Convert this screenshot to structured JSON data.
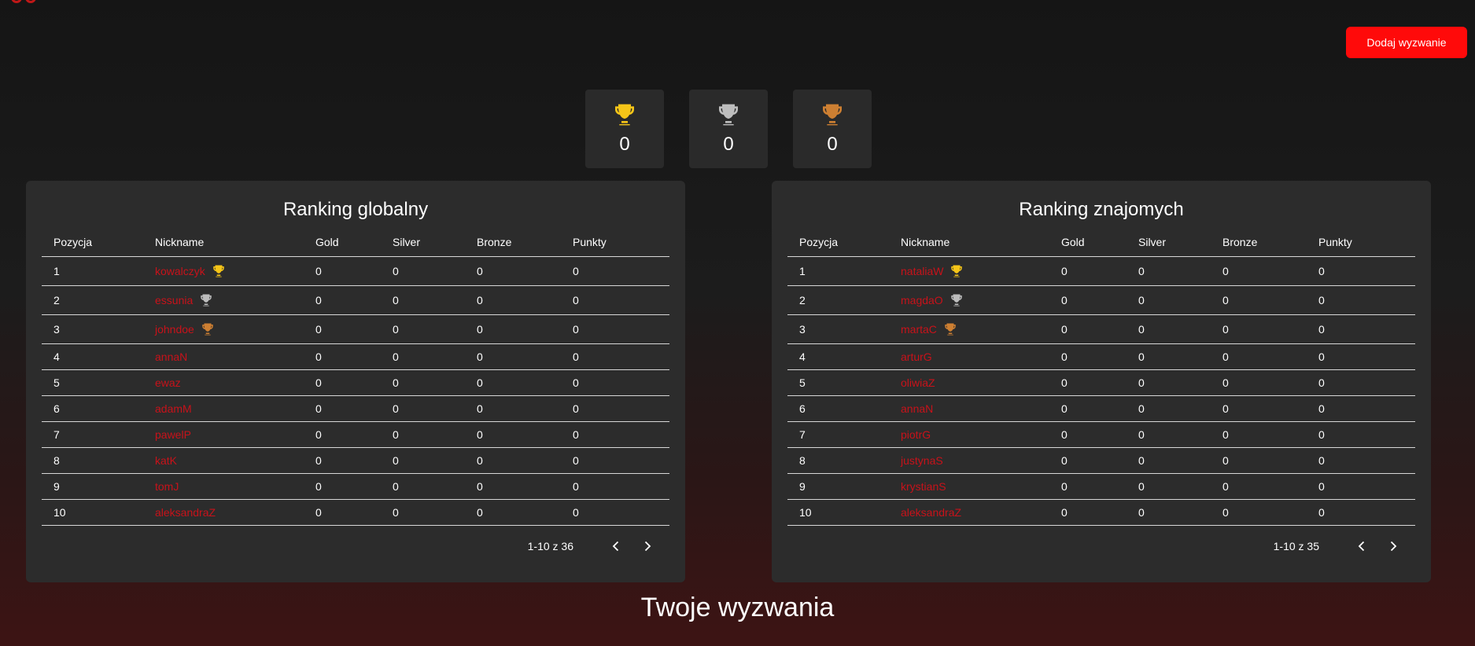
{
  "colors": {
    "accent": "#ff0a0a",
    "nickname": "#c8121a",
    "gold": "#f5c518",
    "silver": "#bdbdbd",
    "bronze": "#cd7f32"
  },
  "header": {
    "add_challenge_label": "Dodaj wyzwanie"
  },
  "trophies": [
    {
      "medal": "gold",
      "icon": "trophy-icon",
      "count": "0"
    },
    {
      "medal": "silver",
      "icon": "trophy-icon",
      "count": "0"
    },
    {
      "medal": "bronze",
      "icon": "trophy-icon",
      "count": "0"
    }
  ],
  "rankings": [
    {
      "title": "Ranking globalny",
      "columns": [
        "Pozycja",
        "Nickname",
        "Gold",
        "Silver",
        "Bronze",
        "Punkty"
      ],
      "rows": [
        {
          "pos": "1",
          "nick": "kowalczyk",
          "medal": "gold",
          "gold": "0",
          "silver": "0",
          "bronze": "0",
          "points": "0"
        },
        {
          "pos": "2",
          "nick": "essunia",
          "medal": "silver",
          "gold": "0",
          "silver": "0",
          "bronze": "0",
          "points": "0"
        },
        {
          "pos": "3",
          "nick": "johndoe",
          "medal": "bronze",
          "gold": "0",
          "silver": "0",
          "bronze": "0",
          "points": "0"
        },
        {
          "pos": "4",
          "nick": "annaN",
          "medal": "",
          "gold": "0",
          "silver": "0",
          "bronze": "0",
          "points": "0"
        },
        {
          "pos": "5",
          "nick": "ewaz",
          "medal": "",
          "gold": "0",
          "silver": "0",
          "bronze": "0",
          "points": "0"
        },
        {
          "pos": "6",
          "nick": "adamM",
          "medal": "",
          "gold": "0",
          "silver": "0",
          "bronze": "0",
          "points": "0"
        },
        {
          "pos": "7",
          "nick": "pawelP",
          "medal": "",
          "gold": "0",
          "silver": "0",
          "bronze": "0",
          "points": "0"
        },
        {
          "pos": "8",
          "nick": "katK",
          "medal": "",
          "gold": "0",
          "silver": "0",
          "bronze": "0",
          "points": "0"
        },
        {
          "pos": "9",
          "nick": "tomJ",
          "medal": "",
          "gold": "0",
          "silver": "0",
          "bronze": "0",
          "points": "0"
        },
        {
          "pos": "10",
          "nick": "aleksandraZ",
          "medal": "",
          "gold": "0",
          "silver": "0",
          "bronze": "0",
          "points": "0"
        }
      ],
      "pagination": "1-10 z 36"
    },
    {
      "title": "Ranking znajomych",
      "columns": [
        "Pozycja",
        "Nickname",
        "Gold",
        "Silver",
        "Bronze",
        "Punkty"
      ],
      "rows": [
        {
          "pos": "1",
          "nick": "nataliaW",
          "medal": "gold",
          "gold": "0",
          "silver": "0",
          "bronze": "0",
          "points": "0"
        },
        {
          "pos": "2",
          "nick": "magdaO",
          "medal": "silver",
          "gold": "0",
          "silver": "0",
          "bronze": "0",
          "points": "0"
        },
        {
          "pos": "3",
          "nick": "martaC",
          "medal": "bronze",
          "gold": "0",
          "silver": "0",
          "bronze": "0",
          "points": "0"
        },
        {
          "pos": "4",
          "nick": "arturG",
          "medal": "",
          "gold": "0",
          "silver": "0",
          "bronze": "0",
          "points": "0"
        },
        {
          "pos": "5",
          "nick": "oliwiaZ",
          "medal": "",
          "gold": "0",
          "silver": "0",
          "bronze": "0",
          "points": "0"
        },
        {
          "pos": "6",
          "nick": "annaN",
          "medal": "",
          "gold": "0",
          "silver": "0",
          "bronze": "0",
          "points": "0"
        },
        {
          "pos": "7",
          "nick": "piotrG",
          "medal": "",
          "gold": "0",
          "silver": "0",
          "bronze": "0",
          "points": "0"
        },
        {
          "pos": "8",
          "nick": "justynaS",
          "medal": "",
          "gold": "0",
          "silver": "0",
          "bronze": "0",
          "points": "0"
        },
        {
          "pos": "9",
          "nick": "krystianS",
          "medal": "",
          "gold": "0",
          "silver": "0",
          "bronze": "0",
          "points": "0"
        },
        {
          "pos": "10",
          "nick": "aleksandraZ",
          "medal": "",
          "gold": "0",
          "silver": "0",
          "bronze": "0",
          "points": "0"
        }
      ],
      "pagination": "1-10 z 35"
    }
  ],
  "challenges": {
    "title": "Twoje wyzwania"
  }
}
